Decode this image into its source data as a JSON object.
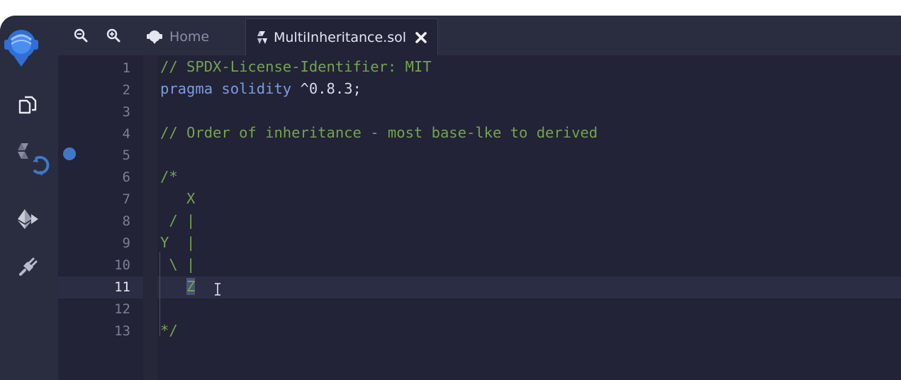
{
  "sidebar": {
    "icons": [
      "remix-logo-icon",
      "file-explorer-icon",
      "solidity-compiler-icon",
      "deploy-run-icon",
      "plugin-manager-icon"
    ]
  },
  "toolbar": {
    "zoom_out_icon": "zoom-out-icon",
    "zoom_in_icon": "zoom-in-icon"
  },
  "tabs": [
    {
      "label": "Home",
      "icon": "home-icon"
    },
    {
      "label": "MultiInheritance.sol",
      "icon": "solidity-file-icon",
      "close_icon": "close-icon"
    }
  ],
  "editor": {
    "active_line": 11,
    "breakpoint_line": 5,
    "line_numbers": [
      "1",
      "2",
      "3",
      "4",
      "5",
      "6",
      "7",
      "8",
      "9",
      "10",
      "11",
      "12",
      "13"
    ],
    "lines": [
      {
        "text": "// SPDX-License-Identifier: MIT"
      },
      {
        "kw1": "pragma",
        "kw2": "solidity",
        "rest": "^0.8.3;"
      },
      {
        "text": ""
      },
      {
        "text": "// Order of inheritance - most base-lke to derived"
      },
      {
        "text": ""
      },
      {
        "text": "/*"
      },
      {
        "text": "   X"
      },
      {
        "text": " / |"
      },
      {
        "text": "Y  |"
      },
      {
        "text": " \\ |"
      },
      {
        "text": "   Z"
      },
      {
        "text": ""
      },
      {
        "text": "*/"
      }
    ]
  },
  "colors": {
    "comment": "#74a34f",
    "keyword": "#7c9cdb",
    "background": "#222336",
    "sidebar": "#2a2c3f",
    "breakpoint": "#3f78c8"
  }
}
